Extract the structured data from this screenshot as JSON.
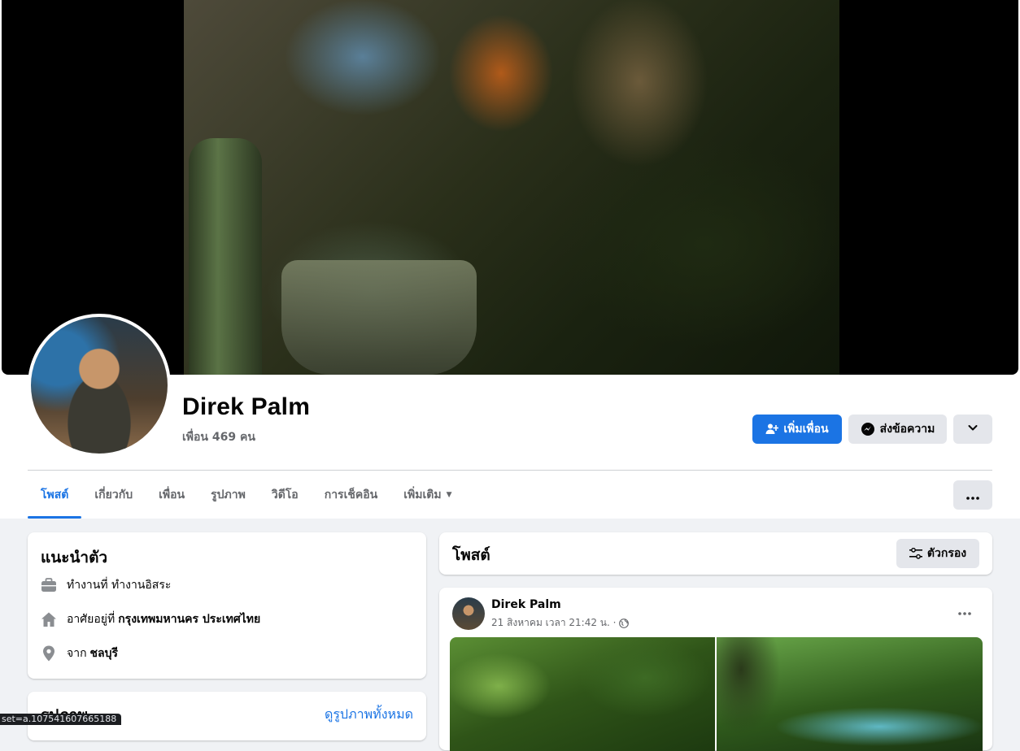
{
  "profile": {
    "name": "Direk Palm",
    "friend_count": "เพื่อน 469 คน"
  },
  "actions": {
    "add_friend": "เพิ่มเพื่อน",
    "message": "ส่งข้อความ"
  },
  "tabs": [
    {
      "label": "โพสต์",
      "active": true
    },
    {
      "label": "เกี่ยวกับ",
      "active": false
    },
    {
      "label": "เพื่อน",
      "active": false
    },
    {
      "label": "รูปภาพ",
      "active": false
    },
    {
      "label": "วิดีโอ",
      "active": false
    },
    {
      "label": "การเช็คอิน",
      "active": false
    },
    {
      "label": "เพิ่มเติม",
      "active": false
    }
  ],
  "intro": {
    "title": "แนะนำตัว",
    "work_prefix": "ทำงานที่ ทำงานอิสระ",
    "lives_prefix": "อาศัยอยู่ที่",
    "lives_value": "กรุงเทพมหานคร ประเทศไทย",
    "from_prefix": "จาก",
    "from_value": "ชลบุรี"
  },
  "photos": {
    "title": "รูปภาพ",
    "see_all": "ดูรูปภาพทั้งหมด"
  },
  "posts": {
    "title": "โพสต์",
    "filter": "ตัวกรอง"
  },
  "post": {
    "author": "Direk Palm",
    "timestamp": "21 สิงหาคม เวลา 21:42 น. ·"
  },
  "status_bar": {
    "url": "set=a.107541607665188"
  },
  "colors": {
    "accent": "#1b74e4",
    "page_bg": "#f0f2f5",
    "secondary_button": "#e4e6eb",
    "muted_text": "#65676b"
  }
}
